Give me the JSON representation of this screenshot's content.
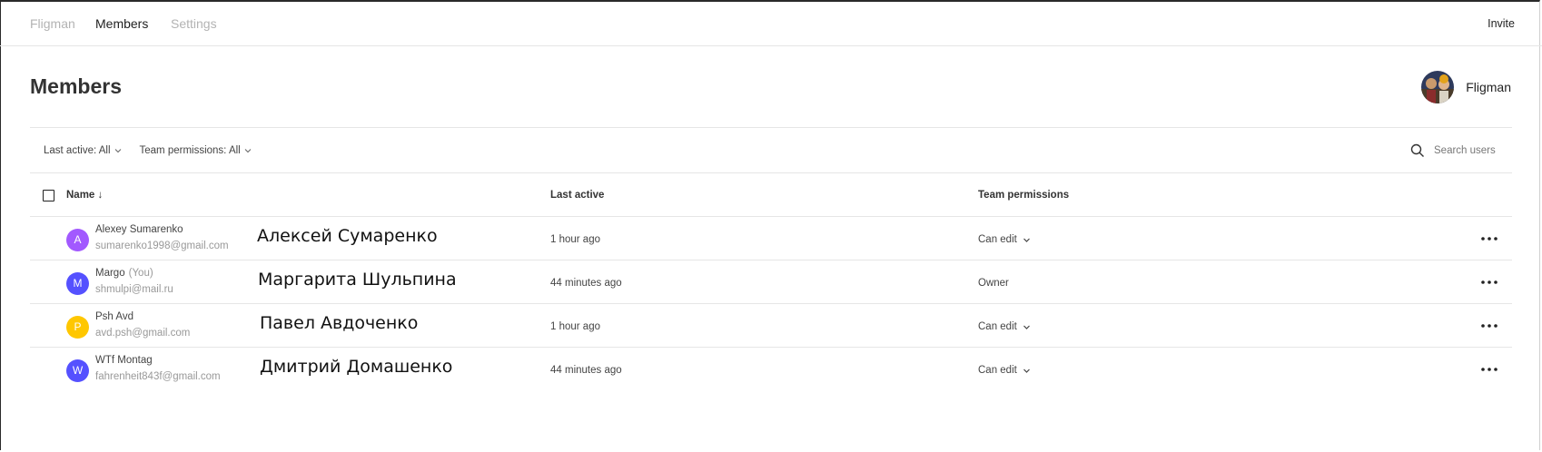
{
  "nav": {
    "brand": "Fligman",
    "members_tab": "Members",
    "settings_tab": "Settings",
    "invite": "Invite"
  },
  "page": {
    "title": "Members",
    "profile_name": "Fligman"
  },
  "filters": {
    "last_active": "Last active: All",
    "team_permissions": "Team permissions: All"
  },
  "search": {
    "placeholder": "Search users"
  },
  "table": {
    "headers": {
      "name": "Name ↓",
      "last_active": "Last active",
      "team_permissions": "Team permissions"
    },
    "rows": [
      {
        "initial": "A",
        "avatar_color": "#a259ff",
        "name": "Alexey Sumarenko",
        "you": "",
        "email": "sumarenko1998@gmail.com",
        "annotation": "Алексей Сумаренко",
        "last_active": "1 hour ago",
        "permission": "Can edit"
      },
      {
        "initial": "M",
        "avatar_color": "#5551ff",
        "name": "Margo",
        "you": "(You)",
        "email": "shmulpi@mail.ru",
        "annotation": "Маргарита Шульпина",
        "last_active": "44 minutes ago",
        "permission": "Owner"
      },
      {
        "initial": "P",
        "avatar_color": "#ffc700",
        "name": "Psh Avd",
        "you": "",
        "email": "avd.psh@gmail.com",
        "annotation": "Павел Авдоченко",
        "last_active": "1 hour ago",
        "permission": "Can edit"
      },
      {
        "initial": "W",
        "avatar_color": "#5551ff",
        "name": "WTf Montag",
        "you": "",
        "email": "fahrenheit843f@gmail.com",
        "annotation": "Дмитрий Домашенко",
        "last_active": "44 minutes ago",
        "permission": "Can edit"
      }
    ]
  }
}
